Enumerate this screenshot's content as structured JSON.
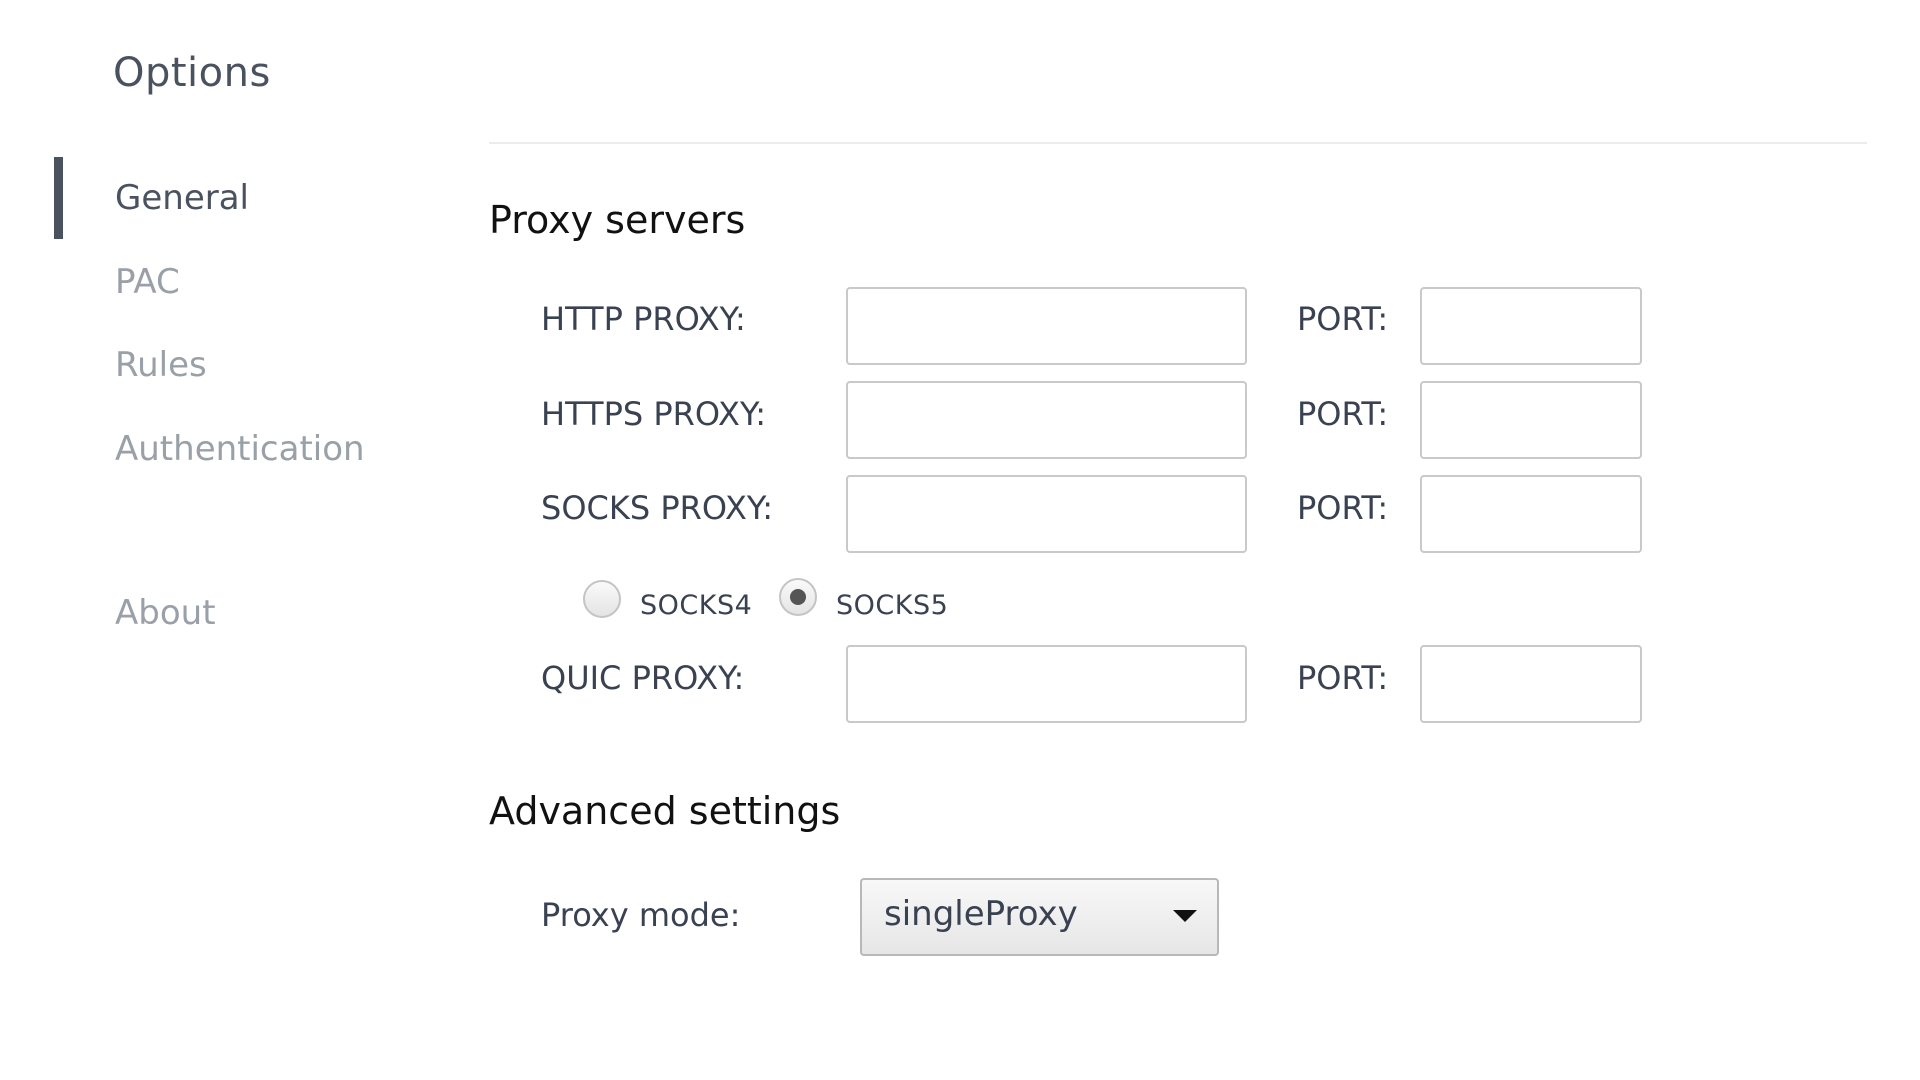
{
  "page": {
    "title": "Options"
  },
  "sidebar": {
    "items": [
      {
        "label": "General",
        "active": true
      },
      {
        "label": "PAC",
        "active": false
      },
      {
        "label": "Rules",
        "active": false
      },
      {
        "label": "Authentication",
        "active": false
      },
      {
        "label": "About",
        "active": false
      }
    ]
  },
  "proxy_servers": {
    "title": "Proxy servers",
    "rows": [
      {
        "label": "HTTP PROXY:",
        "value": "",
        "port_label": "PORT:",
        "port_value": ""
      },
      {
        "label": "HTTPS PROXY:",
        "value": "",
        "port_label": "PORT:",
        "port_value": ""
      },
      {
        "label": "SOCKS PROXY:",
        "value": "",
        "port_label": "PORT:",
        "port_value": ""
      },
      {
        "label": "QUIC PROXY:",
        "value": "",
        "port_label": "PORT:",
        "port_value": ""
      }
    ],
    "socks_version": {
      "options": [
        {
          "label": "SOCKS4",
          "checked": false
        },
        {
          "label": "SOCKS5",
          "checked": true
        }
      ]
    }
  },
  "advanced": {
    "title": "Advanced settings",
    "proxy_mode_label": "Proxy mode:",
    "proxy_mode_value": "singleProxy"
  }
}
